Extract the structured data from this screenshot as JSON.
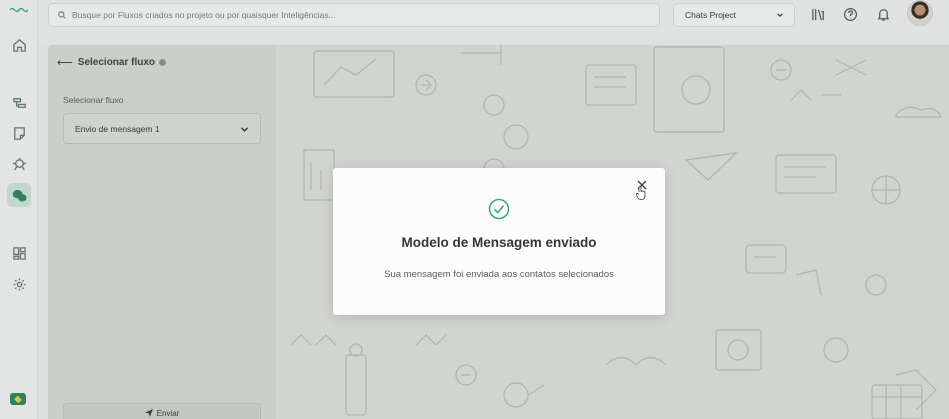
{
  "topbar": {
    "search_placeholder": "Busque por Fluxos criados no projeto ou por quaisquer Inteligências...",
    "project_name": "Chats Project"
  },
  "nav": {
    "items": [
      "home-icon",
      "flows-icon",
      "notes-icon",
      "robot-icon",
      "chat-icon",
      "dashboard-icon",
      "settings-icon"
    ],
    "active": "chat-icon"
  },
  "panel": {
    "title": "Selecionar fluxo",
    "field_label": "Selecionar fluxo",
    "selected_flow": "Envio de mensagem 1",
    "send_label": "Enviar"
  },
  "modal": {
    "title": "Modelo de Mensagem enviado",
    "message": "Sua mensagem foi enviada aos contatos selecionados"
  },
  "colors": {
    "accent": "#2e8a5f",
    "check": "#3aa875"
  }
}
